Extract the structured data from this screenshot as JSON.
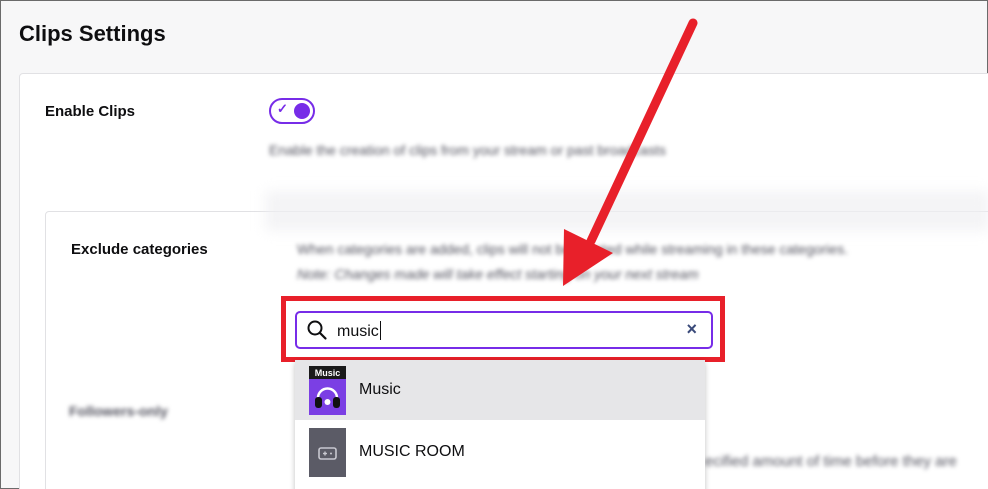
{
  "page": {
    "title": "Clips Settings"
  },
  "enable_clips": {
    "label": "Enable Clips",
    "toggle_on": true,
    "description": "Enable the creation of clips from your stream or past broadcasts"
  },
  "exclude_categories": {
    "label": "Exclude categories",
    "description_line1": "When categories are added, clips will not be created while streaming in these categories.",
    "description_line2": "Note: Changes made will take effect starting on your next stream",
    "search": {
      "value": "music",
      "clear_icon": "close-icon"
    },
    "results": [
      {
        "label": "Music",
        "thumb_text": "Music",
        "highlighted": true
      },
      {
        "label": "MUSIC ROOM",
        "thumb_text": "",
        "highlighted": false
      }
    ]
  },
  "followers_only": {
    "label": "Followers-only",
    "description_fragment": "ecified amount of time before they are"
  },
  "colors": {
    "accent": "#772ce8",
    "annotation": "#e8202a"
  }
}
